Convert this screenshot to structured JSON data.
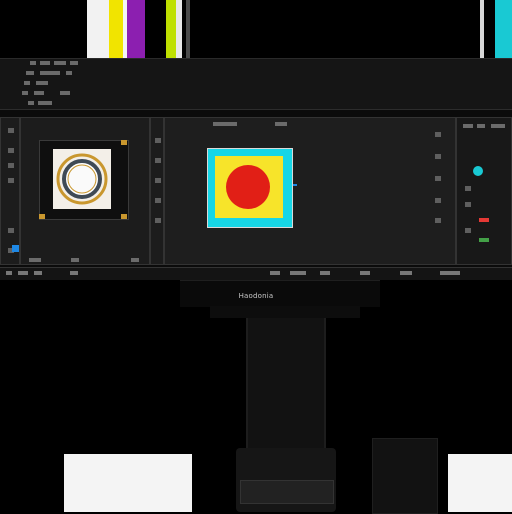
{
  "colors": {
    "bar_white": "#f2f2f2",
    "bar_yellow": "#f1e400",
    "bar_purple": "#8c1fb0",
    "bar_lime": "#bfe000",
    "bar_cyan": "#19c9d3",
    "canvas_cyan": "#16d6e6",
    "canvas_yellow": "#f7e42a",
    "canvas_red": "#e11f16",
    "accent_blue": "#1e88e5",
    "status_red": "#e53935",
    "status_green": "#43a047",
    "ring_gold": "#c9972e"
  },
  "icons": {
    "left_toolbar": [
      "tool-icon",
      "tool-icon",
      "tool-icon",
      "tool-icon",
      "tool-icon",
      "tool-icon"
    ],
    "right_panel": [
      "swatch-icon",
      "swatch-icon",
      "slider-icon",
      "layer-icon"
    ]
  },
  "monitor": {
    "brand_label": "Haodonia"
  }
}
